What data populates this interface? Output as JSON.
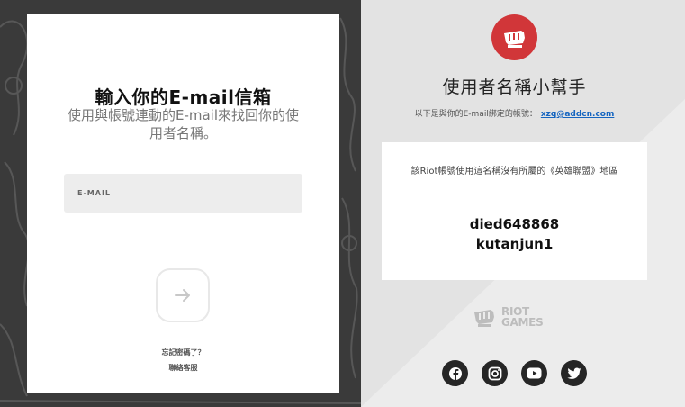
{
  "login_card": {
    "title": "輸入你的E-mail信箱",
    "subtitle": "使用與帳號連動的E-mail來找回你的使用者名稱。",
    "email_placeholder": "E-MAIL",
    "forgot_link": "忘記密碼了？",
    "support_link": "聯絡客服",
    "next_icon": "arrow-right-icon"
  },
  "username_helper": {
    "logo_icon": "riot-fist-icon",
    "title": "使用者名稱小幫手",
    "bound_prefix": "以下是與你的E-mail綁定的帳號：",
    "bound_email": "xzq@addcn.com",
    "note": "該Riot帳號使用這名稱沒有所屬的《英雄聯盟》地區",
    "usernames": [
      "died648868",
      "kutanjun1"
    ],
    "footer_logo_lines": [
      "RIOT",
      "GAMES"
    ],
    "social_icons": [
      "facebook-icon",
      "instagram-icon",
      "youtube-icon",
      "twitter-icon"
    ]
  },
  "colors": {
    "accent_red": "#d13639",
    "link_blue": "#1565c0",
    "dark_bg": "#3a3a3a",
    "light_bg": "#ececec"
  }
}
